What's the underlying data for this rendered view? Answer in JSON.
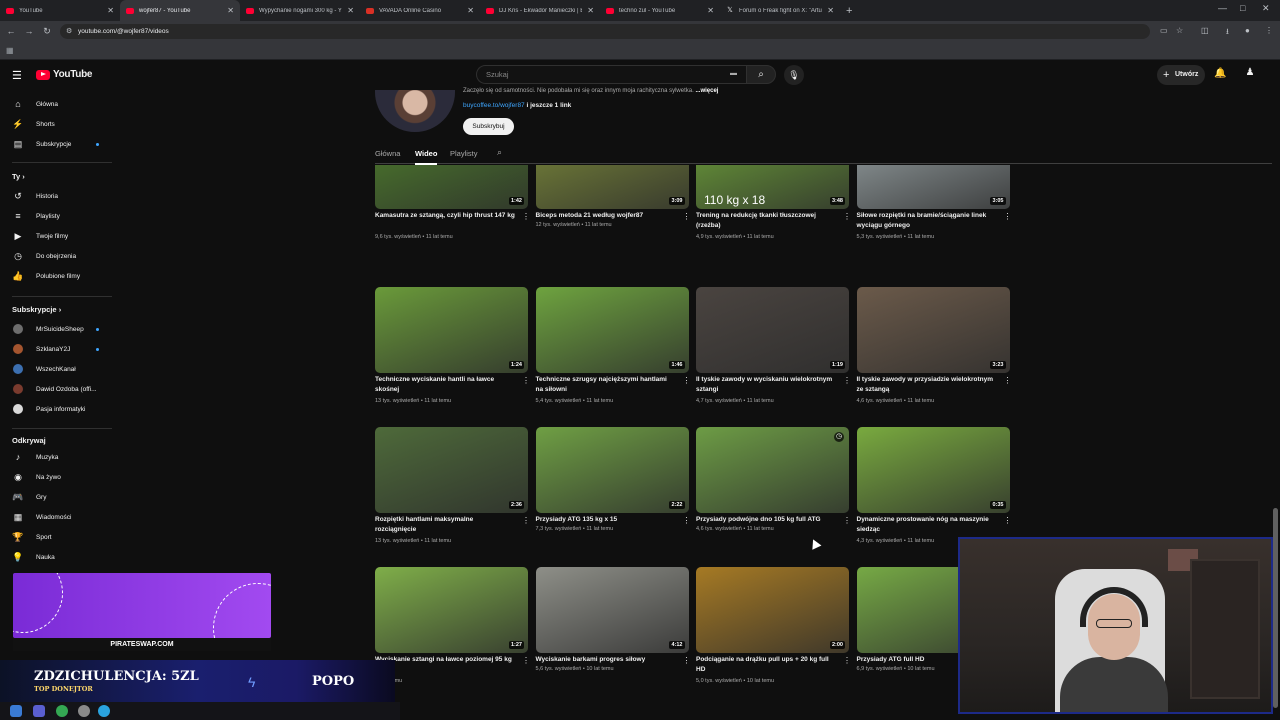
{
  "colors": {
    "accent": "#ff0033",
    "link": "#3ea6ff",
    "bg": "#0f0f0f"
  },
  "browser": {
    "tabs": [
      {
        "title": "YouTube",
        "icon": "youtube-icon",
        "active": false
      },
      {
        "title": "wojfer87 - YouTube",
        "icon": "youtube-icon",
        "active": true
      },
      {
        "title": "Wypychanie nogami 300 kg - Y",
        "icon": "youtube-icon",
        "active": false
      },
      {
        "title": "VAVADA Online Casino",
        "icon": "casino-icon",
        "active": false
      },
      {
        "title": "DJ Kris - Ekwador Manieczki | B",
        "icon": "youtube-icon",
        "active": false
      },
      {
        "title": "techno żul - YouTube",
        "icon": "youtube-icon",
        "active": false
      },
      {
        "title": "Forum o Freak fight on X: \"Artu",
        "icon": "x-icon",
        "active": false
      }
    ],
    "url": "youtube.com/@wojfer87/videos"
  },
  "header": {
    "logo_text": "YouTube",
    "search_placeholder": "Szukaj",
    "create_label": "Utwórz"
  },
  "sidebar": {
    "main": [
      {
        "label": "Główna",
        "icon": "home-icon"
      },
      {
        "label": "Shorts",
        "icon": "shorts-icon"
      },
      {
        "label": "Subskrypcje",
        "icon": "subscriptions-icon"
      }
    ],
    "you_heading": "Ty",
    "you": [
      {
        "label": "Historia",
        "icon": "history-icon"
      },
      {
        "label": "Playlisty",
        "icon": "playlists-icon"
      },
      {
        "label": "Twoje filmy",
        "icon": "your-videos-icon"
      },
      {
        "label": "Do obejrzenia",
        "icon": "watch-later-icon"
      },
      {
        "label": "Polubione filmy",
        "icon": "liked-icon"
      }
    ],
    "subs_heading": "Subskrypcje",
    "subs": [
      {
        "label": "MrSuicideSheep",
        "color": "#6d6d6d"
      },
      {
        "label": "SzklanaY2J",
        "color": "#a4552f"
      },
      {
        "label": "WszechKanał",
        "color": "#3c6fb0"
      },
      {
        "label": "Dawid Ozdoba (offi...",
        "color": "#7a3b2e"
      },
      {
        "label": "Pasja informatyki",
        "color": "#d9d9d9"
      }
    ],
    "explore_heading": "Odkrywaj",
    "explore": [
      {
        "label": "Muzyka",
        "icon": "music-icon"
      },
      {
        "label": "Na żywo",
        "icon": "live-icon"
      },
      {
        "label": "Gry",
        "icon": "gaming-icon"
      },
      {
        "label": "Wiadomości",
        "icon": "news-icon"
      },
      {
        "label": "Sport",
        "icon": "sport-icon"
      },
      {
        "label": "Nauka",
        "icon": "learning-icon"
      }
    ]
  },
  "channel": {
    "description": "Zaczęło się od samotności. Nie podobała mi się oraz innym moja rachityczna sylwetka.",
    "more_label": "...więcej",
    "link_text": "buycoffee.to/wojfer87",
    "link_more": "i jeszcze 1 link",
    "subscribe_label": "Subskrybuj",
    "tabs": [
      "Główna",
      "Wideo",
      "Playlisty"
    ],
    "active_tab": "Wideo"
  },
  "videos": [
    {
      "title": "Kamasutra ze sztangą, czyli hip thrust 147 kg",
      "meta": "9,6 tys. wyświetleń • 11 lat temu",
      "duration": "1:42",
      "bg": "#4f7f2c"
    },
    {
      "title": "Biceps metoda 21 według wojfer87",
      "meta": "12 tys. wyświetleń • 11 lat temu",
      "duration": "3:09",
      "bg": "#7c8a3a"
    },
    {
      "title": "Trening na redukcję tkanki tłuszczowej (rzeźba)",
      "meta": "4,9 tys. wyświetleń • 11 lat temu",
      "duration": "3:48",
      "bg": "#6fa33a",
      "overlay": "110 kg x 18"
    },
    {
      "title": "Siłowe rozpiętki na bramie/ściąganie linek wyciągu górnego",
      "meta": "5,3 tys. wyświetleń • 11 lat temu",
      "duration": "3:05",
      "bg": "#9aa4a6"
    },
    {
      "title": "Techniczne wyciskanie hantli na ławce skośnej",
      "meta": "13 tys. wyświetleń • 11 lat temu",
      "duration": "1:24",
      "bg": "#6a9a3a"
    },
    {
      "title": "Techniczne szrugsy najcięższymi hantlami na siłowni",
      "meta": "5,4 tys. wyświetleń • 11 lat temu",
      "duration": "1:46",
      "bg": "#6ea33f"
    },
    {
      "title": "II tyskie zawody w wyciskaniu wielokrotnym sztangi",
      "meta": "4,7 tys. wyświetleń • 11 lat temu",
      "duration": "1:19",
      "bg": "#4a4440"
    },
    {
      "title": "II tyskie zawody w przysiadzie wielokrotnym ze sztangą",
      "meta": "4,6 tys. wyświetleń • 11 lat temu",
      "duration": "3:23",
      "bg": "#6b5a4a"
    },
    {
      "title": "Rozpiętki hantlami maksymalne rozciągnięcie",
      "meta": "13 tys. wyświetleń • 11 lat temu",
      "duration": "2:36",
      "bg": "#4e6a3a"
    },
    {
      "title": "Przysiady ATG 135 kg x 15",
      "meta": "7,3 tys. wyświetleń • 11 lat temu",
      "duration": "2:22",
      "bg": "#6f9f44"
    },
    {
      "title": "Przysiady podwójne dno 105 kg full ATG",
      "meta": "4,6 tys. wyświetleń • 11 lat temu",
      "duration": "",
      "bg": "#6d9c45",
      "watch_later": true
    },
    {
      "title": "Dynamiczne prostowanie nóg na maszynie siedząc",
      "meta": "4,3 tys. wyświetleń • 11 lat temu",
      "duration": "0:35",
      "bg": "#79aa3f"
    },
    {
      "title": "Wyciskanie sztangi na ławce poziomej 95 kg",
      "meta": "10 lat temu",
      "duration": "1:27",
      "bg": "#7fae49"
    },
    {
      "title": "Wyciskanie barkami progres siłowy",
      "meta": "5,6 tys. wyświetleń • 10 lat temu",
      "duration": "4:12",
      "bg": "#8e8f88"
    },
    {
      "title": "Podciąganie na drążku pull ups + 20 kg full HD",
      "meta": "5,0 tys. wyświetleń • 10 lat temu",
      "duration": "2:00",
      "bg": "#a67a24"
    },
    {
      "title": "Przysiady ATG full HD",
      "meta": "6,9 tys. wyświetleń • 10 lat temu",
      "duration": "",
      "bg": "#76a945"
    }
  ],
  "stream": {
    "promo_url": "PIRATESWAP.COM",
    "donor_name": "ZDZICHULENCJA: 5ZL",
    "donor_sub": "TOP DONEJTOR",
    "donor_msg": "POPO"
  }
}
